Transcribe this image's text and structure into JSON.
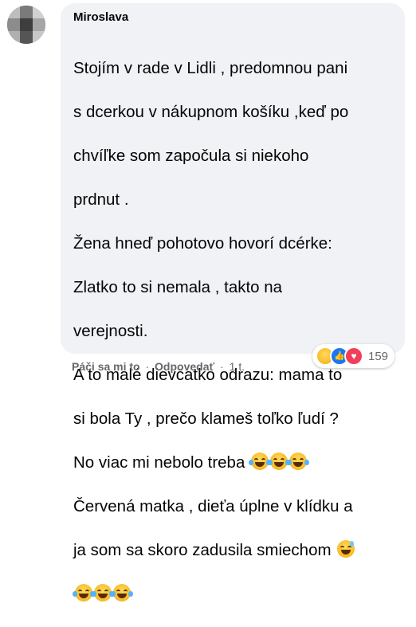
{
  "comment": {
    "author": "Miroslava",
    "lines": [
      "Stojím v rade v Lidli , predomnou pani",
      "s dcerkou v nákupnom košíku ,keď po",
      "chvíľke som započula si niekoho",
      "prdnut .",
      "Žena hneď pohotovo hovorí dcérke:",
      "Zlatko to si nemala , takto na",
      "verejnosti.",
      "A to malé dievčatko odrazu: mama to",
      "si bola Ty , prečo klameš toľko ľudí ?",
      "No viac mi nebolo treba",
      "Červená matka , dieťa úplne v klídku a",
      "ja som sa skoro zadusila smiechom",
      ""
    ],
    "emoji": {
      "line10": [
        "tears-of-joy",
        "tears-of-joy",
        "tears-of-joy"
      ],
      "line12": [
        "grinning-sweat"
      ],
      "line13": [
        "tears-of-joy",
        "tears-of-joy",
        "tears-of-joy"
      ]
    }
  },
  "actions": {
    "like": "Páči sa mi to",
    "separator": "·",
    "reply": "Odpovedať",
    "time": "1 t."
  },
  "reactions": {
    "icons": [
      "haha-icon",
      "like-icon",
      "love-icon"
    ],
    "count": "159"
  },
  "colors": {
    "bubble": "#f0f2f5",
    "secondary_text": "#65676b",
    "like": "#1877f2",
    "love": "#f33e58"
  }
}
